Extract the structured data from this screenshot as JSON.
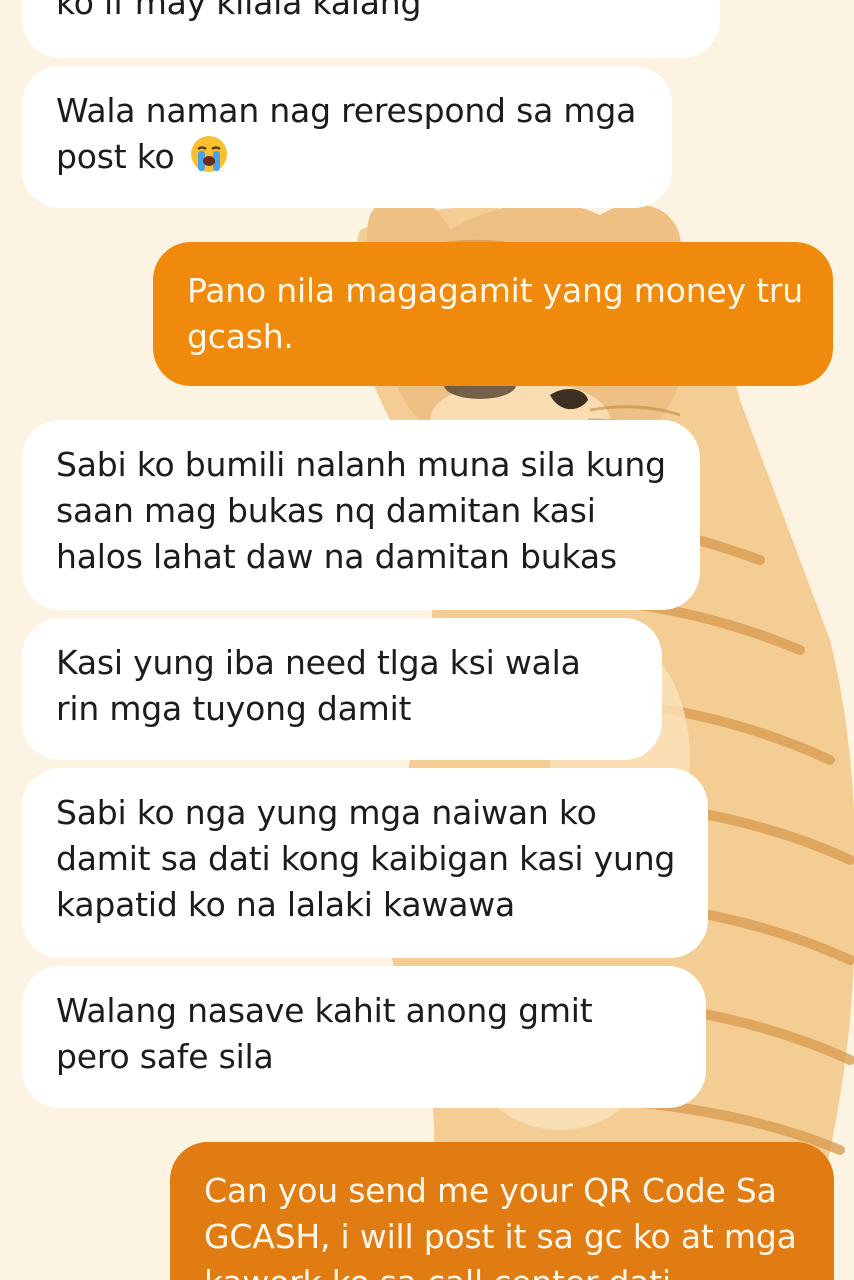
{
  "colors": {
    "background": "#fdf3e2",
    "incoming_bubble": "#ffffff",
    "outgoing_bubble_1": "#f08a0c",
    "outgoing_bubble_2": "#e17c12",
    "incoming_text": "#1c1c1c",
    "outgoing_text": "#fff7ea"
  },
  "wallpaper": {
    "icon": "orange-tabby-cat-illustration"
  },
  "messages": [
    {
      "direction": "incoming",
      "text": "ko if may kilala kalang"
    },
    {
      "direction": "incoming",
      "text": "Wala naman nag rerespond sa mga post ko",
      "emoji": "loudly-crying-face"
    },
    {
      "direction": "outgoing",
      "text": "Pano nila magagamit yang money tru gcash."
    },
    {
      "direction": "incoming",
      "text": "Sabi ko bumili nalanh muna sila kung saan mag bukas nq damitan kasi halos lahat daw na damitan bukas"
    },
    {
      "direction": "incoming",
      "text": "Kasi yung iba need tlga ksi wala rin mga tuyong damit"
    },
    {
      "direction": "incoming",
      "text": "Sabi ko nga yung mga naiwan ko damit sa dati kong kaibigan kasi yung kapatid ko na lalaki kawawa"
    },
    {
      "direction": "incoming",
      "text": "Walang nasave kahit anong gmit pero safe sila"
    },
    {
      "direction": "outgoing",
      "text": "Can you send me your QR Code Sa GCASH, i will post it sa gc ko at mga kawork ko sa call center dati"
    }
  ]
}
